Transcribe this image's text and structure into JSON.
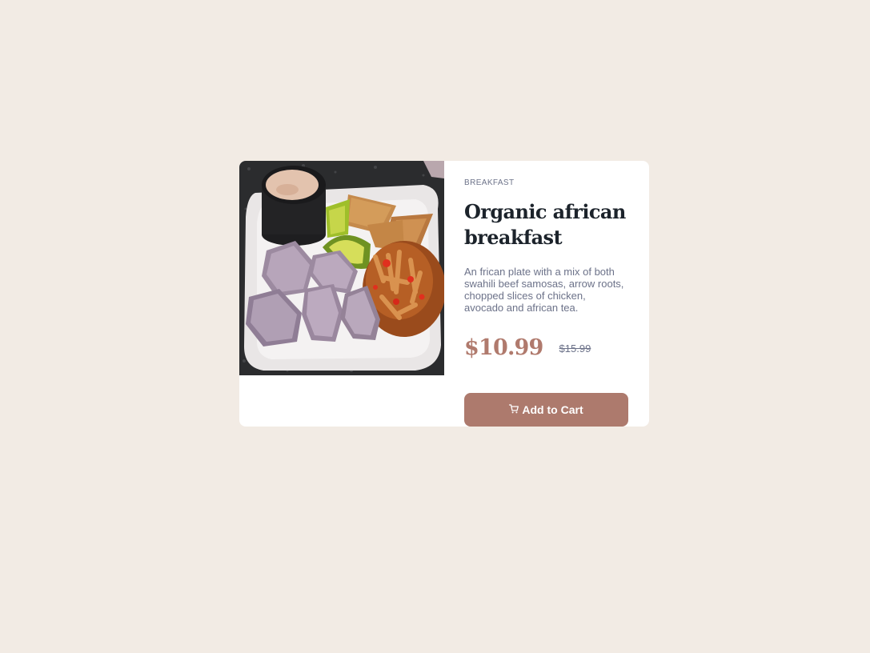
{
  "product": {
    "image_alt": "Organic african breakfast plate",
    "category": "BREAKFAST",
    "title": "Organic african breakfast",
    "description": "An frican plate with a mix of both swahili beef samosas, arrow roots, chopped slices of chicken, avocado and african tea.",
    "price": "$10.99",
    "original_price": "$15.99"
  },
  "actions": {
    "add_to_cart_label": "Add to Cart",
    "cart_icon": "cart-icon"
  },
  "colors": {
    "background": "#f2ebe4",
    "card": "#ffffff",
    "accent": "#ad7a6d",
    "heading": "#1c232b",
    "muted": "#6c7289"
  }
}
